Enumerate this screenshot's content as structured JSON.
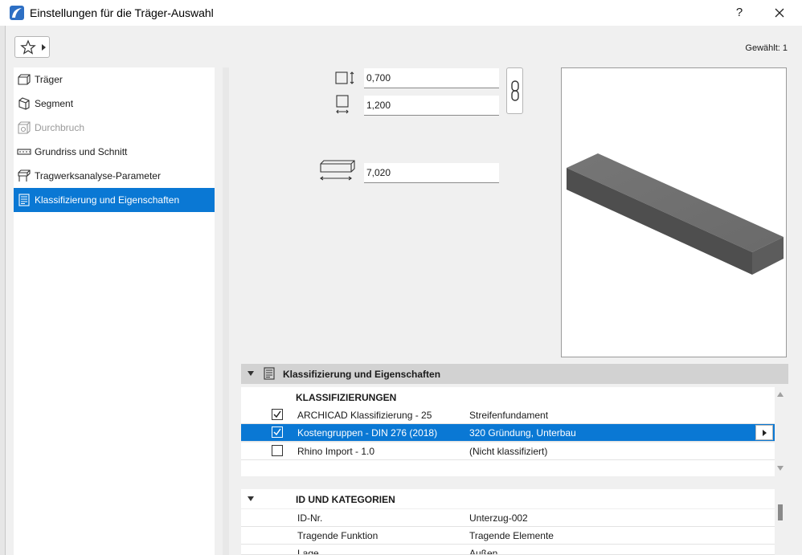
{
  "window": {
    "title": "Einstellungen für die Träger-Auswahl",
    "help_label": "?"
  },
  "toolbar": {
    "selected_count": "Gewählt: 1"
  },
  "nav": {
    "items": [
      {
        "label": "Träger",
        "icon": "beam-icon",
        "state": "normal"
      },
      {
        "label": "Segment",
        "icon": "segment-icon",
        "state": "normal"
      },
      {
        "label": "Durchbruch",
        "icon": "opening-icon",
        "state": "disabled"
      },
      {
        "label": "Grundriss und Schnitt",
        "icon": "floorplan-icon",
        "state": "normal"
      },
      {
        "label": "Tragwerksanalyse-Parameter",
        "icon": "structural-icon",
        "state": "normal"
      },
      {
        "label": "Klassifizierung und Eigenschaften",
        "icon": "classification-icon",
        "state": "selected"
      }
    ]
  },
  "dimensions": {
    "width": "0,700",
    "height": "1,200",
    "length": "7,020"
  },
  "properties": {
    "section_title": "Klassifizierung und Eigenschaften",
    "classifications_header": "KLASSIFIZIERUNGEN",
    "classifications": [
      {
        "checked": true,
        "name": "ARCHICAD Klassifizierung - 25",
        "value": "Streifenfundament",
        "highlighted": false
      },
      {
        "checked": true,
        "name": "Kostengruppen - DIN 276 (2018)",
        "value": "320 Gründung, Unterbau",
        "highlighted": true
      },
      {
        "checked": false,
        "name": "Rhino Import - 1.0",
        "value": "(Nicht klassifiziert)",
        "highlighted": false
      }
    ],
    "id_header": "ID UND KATEGORIEN",
    "id_rows": [
      {
        "name": "ID-Nr.",
        "value": "Unterzug-002"
      },
      {
        "name": "Tragende Funktion",
        "value": "Tragende Elemente"
      },
      {
        "name": "Lage",
        "value": "Außen"
      }
    ]
  },
  "colors": {
    "accent": "#0a78d4",
    "header_bg": "#d2d2d2",
    "beam": "#5a5a5a"
  }
}
